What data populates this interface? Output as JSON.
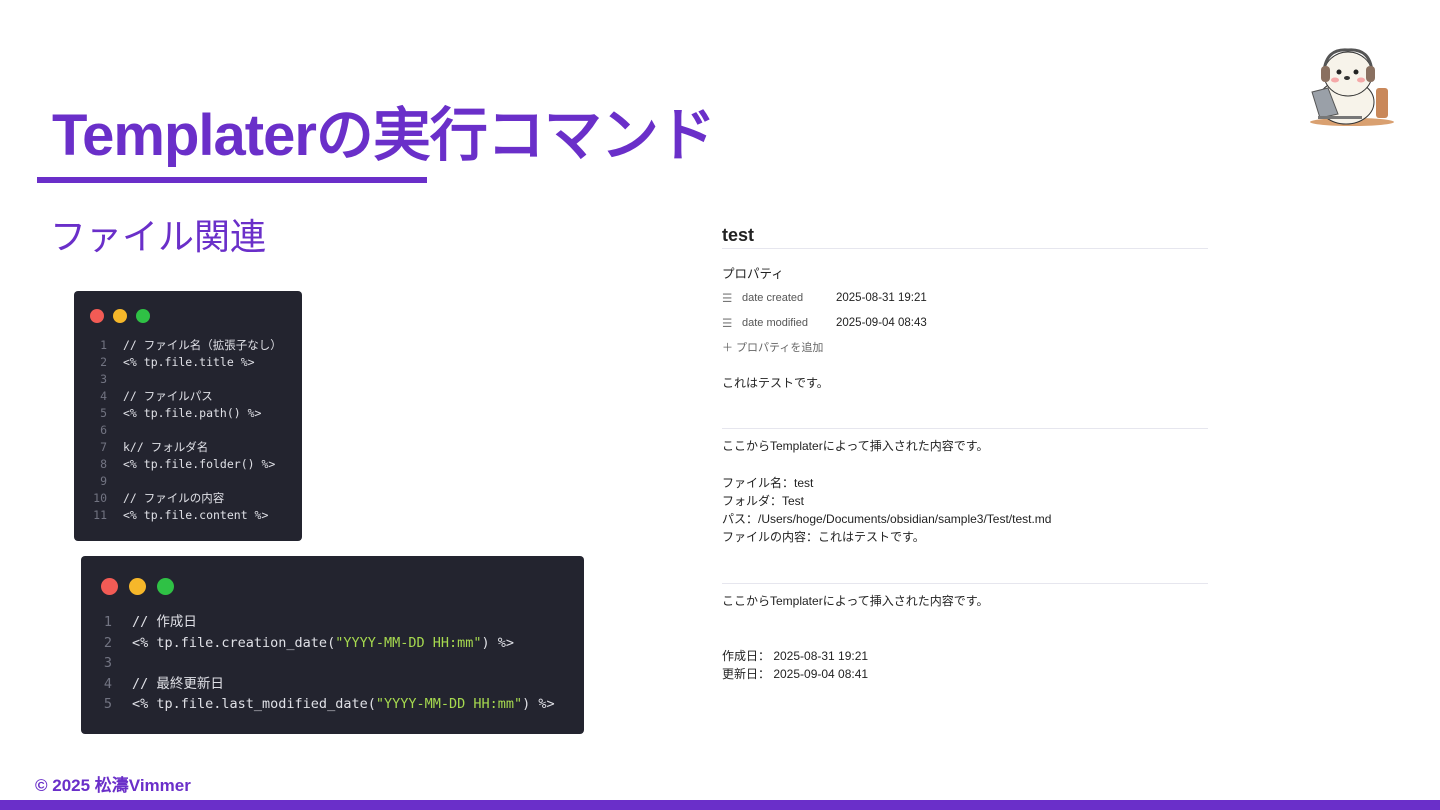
{
  "slide": {
    "title": "Templaterの実行コマンド",
    "subtitle": "ファイル関連",
    "footer": "© 2025 松濤Vimmer",
    "accent_color": "#6a2fc9",
    "mascot_icon": "beaver-with-headphones-laptop-icon"
  },
  "code_block_1": {
    "window_dots": [
      "#f25b55",
      "#f6b72a",
      "#2fc145"
    ],
    "lines": [
      {
        "num": "1",
        "text": "// ファイル名（拡張子なし）"
      },
      {
        "num": "2",
        "text": "<% tp.file.title %>"
      },
      {
        "num": "3",
        "text": ""
      },
      {
        "num": "4",
        "text": "// ファイルパス"
      },
      {
        "num": "5",
        "text": "<% tp.file.path() %>"
      },
      {
        "num": "6",
        "text": ""
      },
      {
        "num": "7",
        "text": "k// フォルダ名"
      },
      {
        "num": "8",
        "text": "<% tp.file.folder() %>"
      },
      {
        "num": "9",
        "text": ""
      },
      {
        "num": "10",
        "text": "// ファイルの内容"
      },
      {
        "num": "11",
        "text": "<% tp.file.content %>"
      }
    ]
  },
  "code_block_2": {
    "window_dots": [
      "#f25b55",
      "#f6b72a",
      "#2fc145"
    ],
    "lines": [
      {
        "num": "1",
        "pre": "// 作成日",
        "str": "",
        "post": ""
      },
      {
        "num": "2",
        "pre": "<% tp.file.creation_date(",
        "str": "\"YYYY-MM-DD HH:mm\"",
        "post": ") %>"
      },
      {
        "num": "3",
        "pre": "",
        "str": "",
        "post": ""
      },
      {
        "num": "4",
        "pre": "// 最終更新日",
        "str": "",
        "post": ""
      },
      {
        "num": "5",
        "pre": "<% tp.file.last_modified_date(",
        "str": "\"YYYY-MM-DD HH:mm\"",
        "post": ") %>"
      }
    ]
  },
  "note": {
    "title": "test",
    "properties_heading": "プロパティ",
    "properties": [
      {
        "icon": "text-lines-icon",
        "key": "date created",
        "value": "2025-08-31 19:21"
      },
      {
        "icon": "text-lines-icon",
        "key": "date modified",
        "value": "2025-09-04 08:43"
      }
    ],
    "add_property_label": "＋ プロパティを追加",
    "body_line": "これはテストです。",
    "section1": {
      "intro": "ここからTemplaterによって挿入された内容です。",
      "lines": [
        "ファイル名：test",
        "フォルダ：Test",
        "パス：/Users/hoge/Documents/obsidian/sample3/Test/test.md",
        "ファイルの内容：これはテストです。"
      ]
    },
    "section2": {
      "intro": "ここからTemplaterによって挿入された内容です。",
      "lines": [
        "作成日： 2025-08-31 19:21",
        "更新日： 2025-09-04 08:41"
      ]
    }
  }
}
